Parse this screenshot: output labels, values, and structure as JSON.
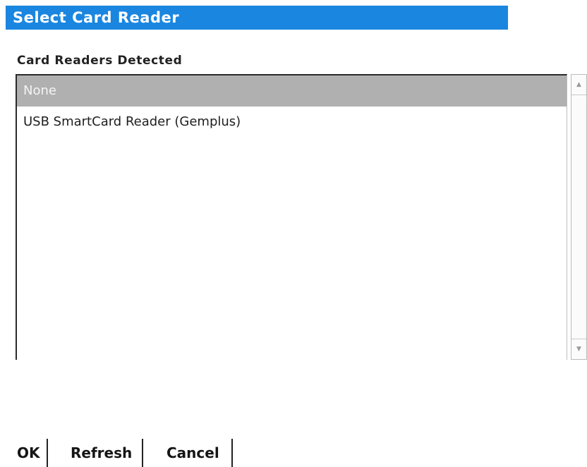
{
  "dialog": {
    "title": "Select Card Reader",
    "section_label": "Card Readers Detected"
  },
  "list": {
    "items": [
      {
        "label": "None",
        "selected": true
      },
      {
        "label": "USB SmartCard Reader (Gemplus)",
        "selected": false
      }
    ]
  },
  "scrollbar": {
    "up_icon": "scroll-up-arrow-icon",
    "down_icon": "scroll-down-arrow-icon"
  },
  "buttons": {
    "ok": "OK",
    "refresh": "Refresh",
    "cancel": "Cancel"
  },
  "colors": {
    "title_bar": "#1a86e0",
    "selection": "#b0b0b0"
  }
}
